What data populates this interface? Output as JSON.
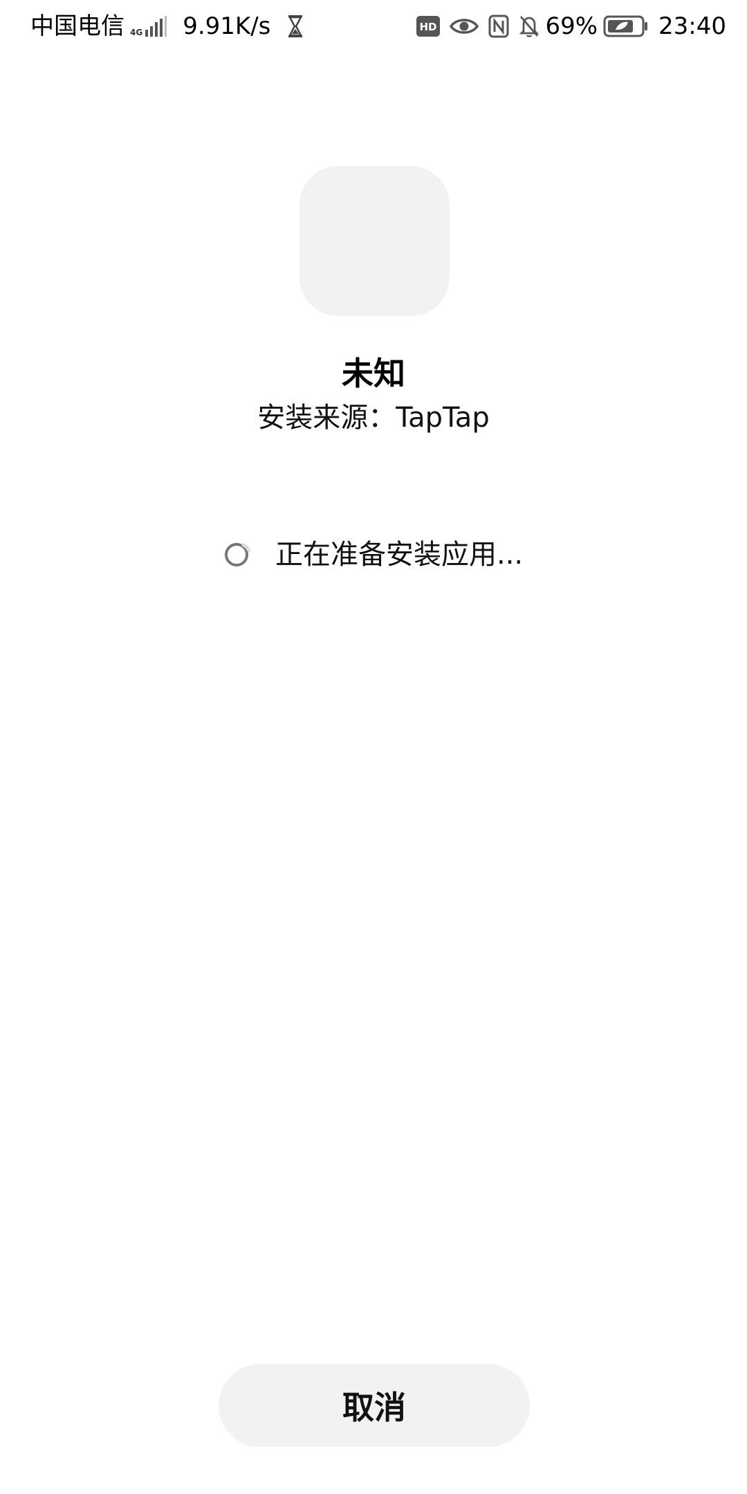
{
  "status_bar": {
    "carrier": "中国电信",
    "network_type": "4G",
    "speed": "9.91K/s",
    "battery_percent": "69%",
    "time": "23:40",
    "icons": [
      "signal-icon",
      "hourglass-icon",
      "hd-icon",
      "eye-icon",
      "nfc-icon",
      "bell-off-icon",
      "battery-icon"
    ]
  },
  "app": {
    "name": "未知",
    "install_source": "安装来源：TapTap"
  },
  "progress": {
    "text": "正在准备安装应用..."
  },
  "actions": {
    "cancel_label": "取消"
  }
}
